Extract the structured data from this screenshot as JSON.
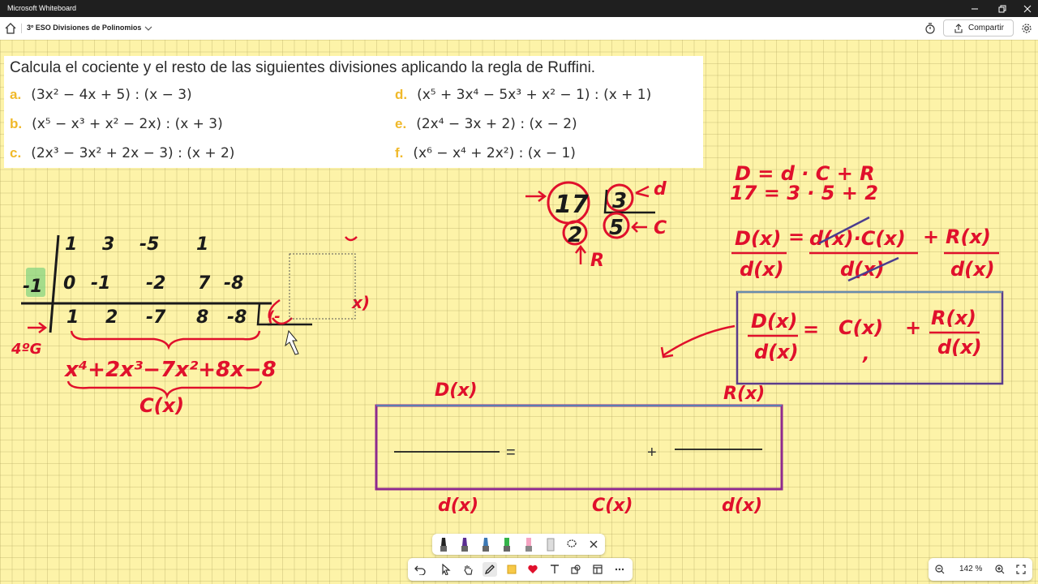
{
  "window": {
    "app_title": "Microsoft Whiteboard"
  },
  "toolbar": {
    "board_title": "3º ESO Divisiones de Polinomios",
    "share_label": "Compartir"
  },
  "exercise": {
    "title": "Calcula el cociente y el resto de las siguientes divisiones aplicando la regla de Ruffini.",
    "items": [
      {
        "letter": "a.",
        "expr": "(3x² − 4x + 5) : (x − 3)"
      },
      {
        "letter": "b.",
        "expr": "(x⁵ − x³ + x² − 2x) : (x + 3)"
      },
      {
        "letter": "c.",
        "expr": "(2x³ − 3x² + 2x − 3) : (x + 2)"
      },
      {
        "letter": "d.",
        "expr": "(x⁵ + 3x⁴ − 5x³ + x² − 1) : (x + 1)"
      },
      {
        "letter": "e.",
        "expr": "(2x⁴ − 3x + 2) : (x − 2)"
      },
      {
        "letter": "f.",
        "expr": "(x⁶ − x⁴ + 2x²) : (x − 1)"
      }
    ]
  },
  "ink": {
    "ruffini_top": [
      "1",
      "3",
      "-5",
      "1"
    ],
    "ruffini_mid": [
      "-1",
      "0",
      "-1",
      "-2",
      "7",
      "-8"
    ],
    "ruffini_bot": [
      "1",
      "2",
      "-7",
      "8",
      "-8"
    ],
    "partial_left": "(-",
    "partial_right": "x)",
    "degree_label": "4ºG",
    "quotient_poly": "x⁴+2x³−7x²+8x−8",
    "quotient_label": "C(x)",
    "numeric_div": {
      "dividend": "17",
      "divisor": "3",
      "remainder": "2",
      "quotient": "5",
      "d": "d",
      "c": "C",
      "r": "R"
    },
    "formula1": "D = d · C + R",
    "formula2": "17 = 3 · 5 + 2",
    "frac_dx": "D(x)",
    "frac_d": "d(x)",
    "frac_dcx": "d(x)·C(x)",
    "frac_rx": "R(x)",
    "eq": "=",
    "plus": "+",
    "cx": "C(x)",
    "dq": "d(x)",
    "box_top_left": "D(x)",
    "box_top_right": "R(x)",
    "box_bot_1": "d(x)",
    "box_bot_2": "C(x)",
    "box_bot_3": "d(x)",
    "box_eq": "=",
    "box_plus": "+",
    "comma": ","
  },
  "zoom": {
    "level": "142 %"
  },
  "colors": {
    "ink_red": "#e0102c",
    "ink_black": "#1a1a1a",
    "accent_green": "#7fd27f"
  }
}
